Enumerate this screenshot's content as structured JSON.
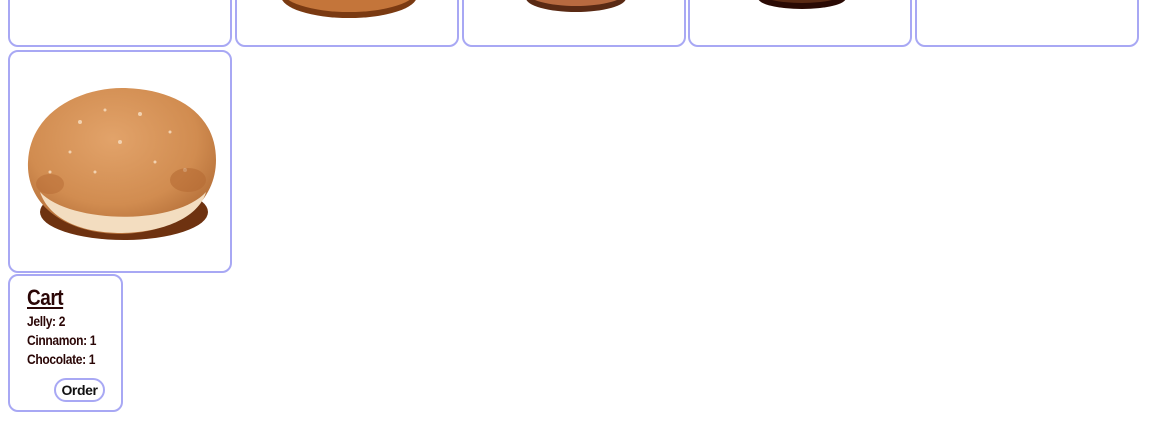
{
  "products": [
    {
      "icon": "product-tile-empty"
    },
    {
      "icon": "donut-icon"
    },
    {
      "icon": "donut-icon"
    },
    {
      "icon": "donut-icon"
    },
    {
      "icon": "product-tile-empty"
    },
    {
      "icon": "jelly-donut-icon"
    }
  ],
  "cart": {
    "title": "Cart",
    "items": [
      {
        "text": "Jelly: 2"
      },
      {
        "text": "Cinnamon: 1"
      },
      {
        "text": "Chocolate: 1"
      }
    ],
    "order_label": "Order"
  },
  "colors": {
    "border": "#a8a8f4",
    "text": "#2a0606"
  }
}
